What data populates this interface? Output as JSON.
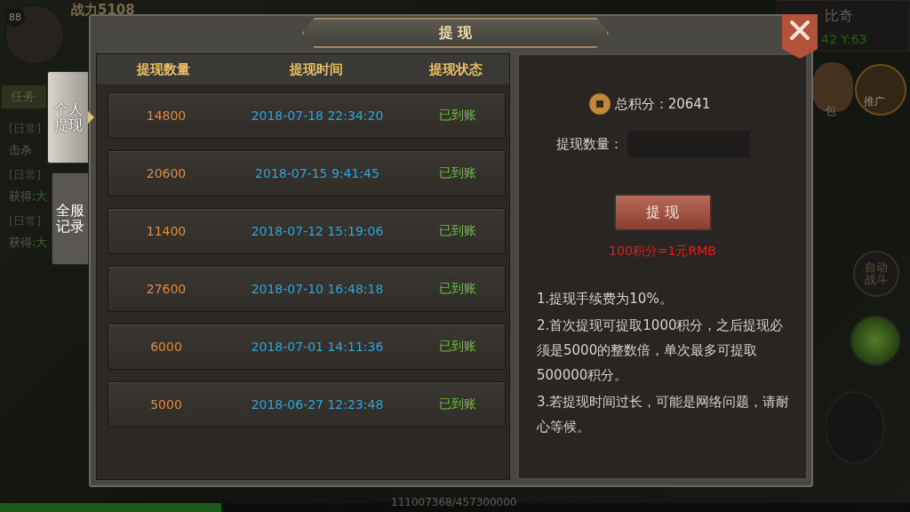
{
  "hud": {
    "level": "88",
    "power": "战力5108",
    "quest_tab": "任务",
    "quest_log": [
      {
        "kind": "title",
        "text": "[日常]"
      },
      {
        "kind": "body",
        "text": "击杀"
      },
      {
        "kind": "title",
        "text": "[日常]"
      },
      {
        "kind": "body",
        "text": "获得:",
        "item": "大"
      },
      {
        "kind": "title",
        "text": "[日常]"
      },
      {
        "kind": "body",
        "text": "获得:",
        "item": "大"
      }
    ],
    "location": "比奇",
    "coords": "42 Y:63",
    "bag_label": "包",
    "promo_label": "推广",
    "auto_battle": "自动战斗",
    "exp": {
      "text": "111007368/457300000",
      "level": 0.243
    }
  },
  "dialog": {
    "title": "提 现",
    "side_tabs": [
      {
        "label": "个人提现",
        "selected": true
      },
      {
        "label": "全服记录",
        "selected": false
      }
    ],
    "table": {
      "columns": [
        "提现数量",
        "提现时间",
        "提现状态"
      ],
      "rows": [
        {
          "amount": "14800",
          "time": "2018-07-18 22:34:20",
          "status": "已到账"
        },
        {
          "amount": "20600",
          "time": "2018-07-15 9:41:45",
          "status": "已到账"
        },
        {
          "amount": "11400",
          "time": "2018-07-12 15:19:06",
          "status": "已到账"
        },
        {
          "amount": "27600",
          "time": "2018-07-10 16:48:18",
          "status": "已到账"
        },
        {
          "amount": "6000",
          "time": "2018-07-01 14:11:36",
          "status": "已到账"
        },
        {
          "amount": "5000",
          "time": "2018-06-27 12:23:48",
          "status": "已到账"
        }
      ]
    },
    "panel": {
      "total": "总积分：20641",
      "amount_label": "提现数量：",
      "button": "提 现",
      "rate": "100积分=1元RMB",
      "notes": [
        "1.提现手续费为10%。",
        "2.首次提现可提取1000积分，之后提现必须是5000的整数倍，单次最多可提取500000积分。",
        "3.若提现时间过长，可能是网络问题，请耐心等候。"
      ]
    }
  }
}
